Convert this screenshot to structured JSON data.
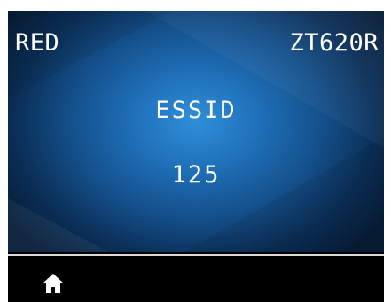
{
  "header": {
    "printer_name": "RED",
    "model": "ZT620R"
  },
  "setting": {
    "name": "ESSID",
    "value": "125"
  },
  "nav": {
    "home_icon": "home-icon"
  },
  "colors": {
    "bezel": "#000000",
    "text": "#ffffff",
    "accent": "#1f6fb8"
  }
}
